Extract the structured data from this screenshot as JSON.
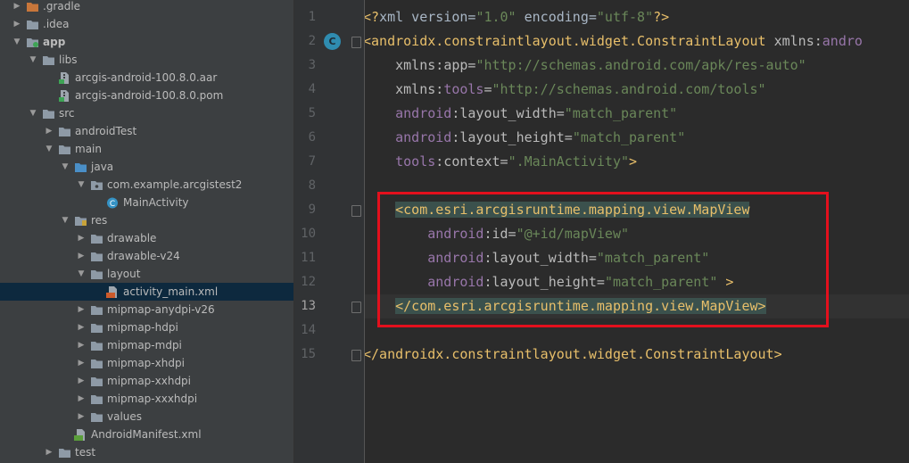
{
  "project_tree": {
    "items": [
      {
        "label": ".gradle",
        "depth": 0,
        "arrow": "collapsed",
        "icon": "folder-orange",
        "bold": false
      },
      {
        "label": ".idea",
        "depth": 0,
        "arrow": "collapsed",
        "icon": "folder",
        "bold": false
      },
      {
        "label": "app",
        "depth": 0,
        "arrow": "expanded",
        "icon": "folder-module",
        "bold": true
      },
      {
        "label": "libs",
        "depth": 1,
        "arrow": "expanded",
        "icon": "folder",
        "bold": false
      },
      {
        "label": "arcgis-android-100.8.0.aar",
        "depth": 2,
        "arrow": "none",
        "icon": "file-archive",
        "bold": false
      },
      {
        "label": "arcgis-android-100.8.0.pom",
        "depth": 2,
        "arrow": "none",
        "icon": "file-archive",
        "bold": false
      },
      {
        "label": "src",
        "depth": 1,
        "arrow": "expanded",
        "icon": "folder",
        "bold": false
      },
      {
        "label": "androidTest",
        "depth": 2,
        "arrow": "collapsed",
        "icon": "folder",
        "bold": false
      },
      {
        "label": "main",
        "depth": 2,
        "arrow": "expanded",
        "icon": "folder",
        "bold": false
      },
      {
        "label": "java",
        "depth": 3,
        "arrow": "expanded",
        "icon": "folder-blue",
        "bold": false
      },
      {
        "label": "com.example.arcgistest2",
        "depth": 4,
        "arrow": "expanded",
        "icon": "package",
        "bold": false
      },
      {
        "label": "MainActivity",
        "depth": 5,
        "arrow": "none",
        "icon": "class",
        "bold": false
      },
      {
        "label": "res",
        "depth": 3,
        "arrow": "expanded",
        "icon": "folder-res",
        "bold": false
      },
      {
        "label": "drawable",
        "depth": 4,
        "arrow": "collapsed",
        "icon": "folder",
        "bold": false
      },
      {
        "label": "drawable-v24",
        "depth": 4,
        "arrow": "collapsed",
        "icon": "folder",
        "bold": false
      },
      {
        "label": "layout",
        "depth": 4,
        "arrow": "expanded",
        "icon": "folder",
        "bold": false
      },
      {
        "label": "activity_main.xml",
        "depth": 5,
        "arrow": "none",
        "icon": "xml-file",
        "bold": false,
        "selected": true
      },
      {
        "label": "mipmap-anydpi-v26",
        "depth": 4,
        "arrow": "collapsed",
        "icon": "folder",
        "bold": false
      },
      {
        "label": "mipmap-hdpi",
        "depth": 4,
        "arrow": "collapsed",
        "icon": "folder",
        "bold": false
      },
      {
        "label": "mipmap-mdpi",
        "depth": 4,
        "arrow": "collapsed",
        "icon": "folder",
        "bold": false
      },
      {
        "label": "mipmap-xhdpi",
        "depth": 4,
        "arrow": "collapsed",
        "icon": "folder",
        "bold": false
      },
      {
        "label": "mipmap-xxhdpi",
        "depth": 4,
        "arrow": "collapsed",
        "icon": "folder",
        "bold": false
      },
      {
        "label": "mipmap-xxxhdpi",
        "depth": 4,
        "arrow": "collapsed",
        "icon": "folder",
        "bold": false
      },
      {
        "label": "values",
        "depth": 4,
        "arrow": "collapsed",
        "icon": "folder",
        "bold": false
      },
      {
        "label": "AndroidManifest.xml",
        "depth": 3,
        "arrow": "none",
        "icon": "manifest-file",
        "bold": false
      },
      {
        "label": "test",
        "depth": 2,
        "arrow": "collapsed",
        "icon": "folder",
        "bold": false
      }
    ]
  },
  "editor": {
    "current_line": 13,
    "lines": [
      {
        "num": "1",
        "tokens": [
          {
            "t": "<?",
            "c": "punct"
          },
          {
            "t": "xml version=",
            "c": "plain"
          },
          {
            "t": "\"1.0\"",
            "c": "str"
          },
          {
            "t": " encoding=",
            "c": "plain"
          },
          {
            "t": "\"utf-8\"",
            "c": "str"
          },
          {
            "t": "?>",
            "c": "punct"
          }
        ]
      },
      {
        "num": "2",
        "gutter_icon": "C",
        "tokens": [
          {
            "t": "<androidx.constraintlayout.widget.ConstraintLayout",
            "c": "tag"
          },
          {
            "t": " xmlns:",
            "c": "attr"
          },
          {
            "t": "andro",
            "c": "ns"
          }
        ]
      },
      {
        "num": "3",
        "tokens": [
          {
            "t": "    xmlns:",
            "c": "attr"
          },
          {
            "t": "app",
            "c": "attr"
          },
          {
            "t": "=",
            "c": "attr"
          },
          {
            "t": "\"http://schemas.android.com/apk/res-auto\"",
            "c": "str"
          }
        ]
      },
      {
        "num": "4",
        "tokens": [
          {
            "t": "    xmlns:",
            "c": "attr"
          },
          {
            "t": "tools",
            "c": "ns"
          },
          {
            "t": "=",
            "c": "attr"
          },
          {
            "t": "\"http://schemas.android.com/tools\"",
            "c": "str"
          }
        ]
      },
      {
        "num": "5",
        "tokens": [
          {
            "t": "    ",
            "c": "plain"
          },
          {
            "t": "android",
            "c": "ns"
          },
          {
            "t": ":layout_width=",
            "c": "attr"
          },
          {
            "t": "\"match_parent\"",
            "c": "str"
          }
        ]
      },
      {
        "num": "6",
        "tokens": [
          {
            "t": "    ",
            "c": "plain"
          },
          {
            "t": "android",
            "c": "ns"
          },
          {
            "t": ":layout_height=",
            "c": "attr"
          },
          {
            "t": "\"match_parent\"",
            "c": "str"
          }
        ]
      },
      {
        "num": "7",
        "tokens": [
          {
            "t": "    ",
            "c": "plain"
          },
          {
            "t": "tools",
            "c": "ns"
          },
          {
            "t": ":context=",
            "c": "attr"
          },
          {
            "t": "\".MainActivity\"",
            "c": "str"
          },
          {
            "t": ">",
            "c": "tag"
          }
        ]
      },
      {
        "num": "8",
        "tokens": []
      },
      {
        "num": "9",
        "tokens": [
          {
            "t": "    ",
            "c": "plain"
          },
          {
            "t": "<",
            "c": "hltag"
          },
          {
            "t": "com.esri.arcgisruntime.mapping.view.MapView",
            "c": "hltag"
          }
        ]
      },
      {
        "num": "10",
        "tokens": [
          {
            "t": "        ",
            "c": "plain"
          },
          {
            "t": "android",
            "c": "ns"
          },
          {
            "t": ":id=",
            "c": "attr"
          },
          {
            "t": "\"@+id/mapView\"",
            "c": "str"
          }
        ]
      },
      {
        "num": "11",
        "tokens": [
          {
            "t": "        ",
            "c": "plain"
          },
          {
            "t": "android",
            "c": "ns"
          },
          {
            "t": ":layout_width=",
            "c": "attr"
          },
          {
            "t": "\"match_parent\"",
            "c": "str"
          }
        ]
      },
      {
        "num": "12",
        "tokens": [
          {
            "t": "        ",
            "c": "plain"
          },
          {
            "t": "android",
            "c": "ns"
          },
          {
            "t": ":layout_height=",
            "c": "attr"
          },
          {
            "t": "\"match_parent\"",
            "c": "str"
          },
          {
            "t": " >",
            "c": "tag"
          }
        ]
      },
      {
        "num": "13",
        "tokens": [
          {
            "t": "    ",
            "c": "plain"
          },
          {
            "t": "</com.esri.arcgisruntime.mapping.view.MapView>",
            "c": "hltag"
          }
        ]
      },
      {
        "num": "14",
        "tokens": []
      },
      {
        "num": "15",
        "tokens": [
          {
            "t": "</androidx.constraintlayout.widget.ConstraintLayout>",
            "c": "tag"
          }
        ]
      }
    ]
  },
  "colors": {
    "tree_bg": "#3c3f41",
    "editor_bg": "#2b2b2b",
    "selection": "#0d293e",
    "annotation_box": "#e3101d",
    "string": "#6a8759",
    "namespace": "#9876aa",
    "tag": "#e8bf6a"
  }
}
